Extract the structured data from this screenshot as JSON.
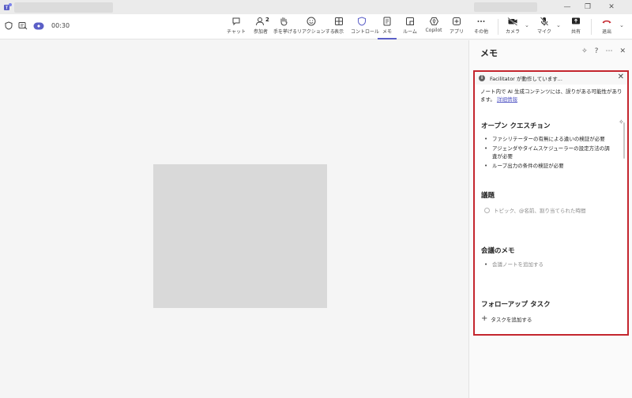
{
  "window": {
    "icons": {
      "app": "teams-icon",
      "restore": "restore-icon",
      "minimize": "minimize-icon",
      "close": "close-icon"
    },
    "controls": {
      "minimize": "—",
      "restore": "❐",
      "close": "✕"
    }
  },
  "toolbar": {
    "timer": "00:30",
    "participants_count": "2",
    "items": {
      "chat": "チャット",
      "people": "参加者",
      "raise": "手を挙げる",
      "react": "リアクションする",
      "view": "表示",
      "control": "コントロール",
      "notes": "メモ",
      "rooms": "ルーム",
      "copilot": "Copilot",
      "apps": "アプリ",
      "more": "その他",
      "camera": "カメラ",
      "mic": "マイク",
      "share": "共有",
      "leave": "退出"
    },
    "colors": {
      "accent": "#5b5fc7",
      "leave": "#c4262e"
    }
  },
  "panel": {
    "title": "メモ",
    "icons": {
      "sparkle": "sparkle-icon",
      "help": "help-icon",
      "more": "more-icon",
      "close": "close-icon"
    },
    "header_glyphs": {
      "sparkle": "✧",
      "help": "?",
      "more": "⋯",
      "close": "✕"
    },
    "facilitator": {
      "info_glyph": "i",
      "status": "Facilitator が動作しています...",
      "close_glyph": "✕"
    },
    "disclaimer": {
      "text": "ノート内で AI 生成コンテンツには、誤りがある可能性があります。",
      "link": "詳細情報"
    },
    "sections": {
      "open_questions": {
        "title": "オープン クエスチョン",
        "items": [
          "ファシリテーターの有無による違いの検証が必要",
          "アジェンダやタイムスケジューラーの設定方法の調査が必要",
          "ループ出力の条件の検証が必要"
        ]
      },
      "agenda": {
        "title": "議題",
        "placeholder": "トピック、@名前、割り当てられた時間"
      },
      "meeting_notes": {
        "title": "会議のメモ",
        "placeholder": "会議ノートを追加する"
      },
      "follow_up": {
        "title": "フォローアップ タスク",
        "add_glyph": "+",
        "add_label": "タスクを追加する"
      }
    },
    "highlight_color": "#c4262e"
  }
}
